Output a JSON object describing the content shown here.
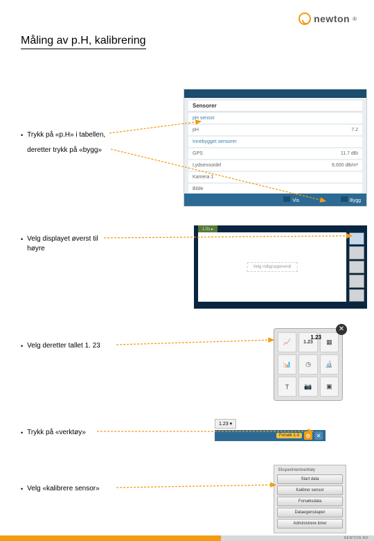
{
  "logo": {
    "text": "newton"
  },
  "title": "Måling av p.H, kalibrering",
  "bullets": [
    {
      "line1": "Trykk på «p.H» i tabellen,",
      "line2": "deretter trykk på «bygg»"
    },
    {
      "line1": "Velg displayet øverst til",
      "line2": "høyre"
    },
    {
      "line1": "Velg deretter tallet 1. 23"
    },
    {
      "line1": "Trykk på «verktøy»"
    },
    {
      "line1": "Velg «kalibrere sensor»"
    }
  ],
  "shot1": {
    "header": "Sensorer",
    "rows": [
      {
        "l": "pH sensor",
        "r": ""
      },
      {
        "l": "pH",
        "r": "7.2"
      },
      {
        "l": "Innebygget sensorer",
        "r": ""
      },
      {
        "l": "GPS",
        "r": "11.7 dBi"
      },
      {
        "l": "Lydsensordel",
        "r": "9,000 dB/m²"
      },
      {
        "l": "Kamera 1",
        "r": ""
      },
      {
        "l": "Bilde",
        "r": ""
      }
    ],
    "bottom_left": "Vis",
    "bottom_right": "Bygg"
  },
  "shot2": {
    "tab": "1.0s ▸",
    "placeholder": "Velg målgruppeverdi"
  },
  "shot3": {
    "value": "1.23",
    "icons": [
      "graph-icon",
      "number-icon",
      "table-icon",
      "chart-icon",
      "clock-icon",
      "scope-icon",
      "text-icon",
      "camera-icon",
      "media-icon"
    ],
    "glyphs": [
      "📈",
      "1.23",
      "▦",
      "📊",
      "◷",
      "🔬",
      "T",
      "📷",
      "▣"
    ]
  },
  "shot4": {
    "tag": "1.23 ▾",
    "chip": "Forsøk 1-3",
    "gear": "⚙",
    "tool": "✕"
  },
  "shot5": {
    "title": "Eksperimentverktøy",
    "items": [
      "Start data",
      "Kalibrer sensor",
      "Forsøksdata",
      "Dataegenskaper",
      "Administrere limer"
    ]
  },
  "footer": {
    "url": "NEWTON.NO"
  }
}
